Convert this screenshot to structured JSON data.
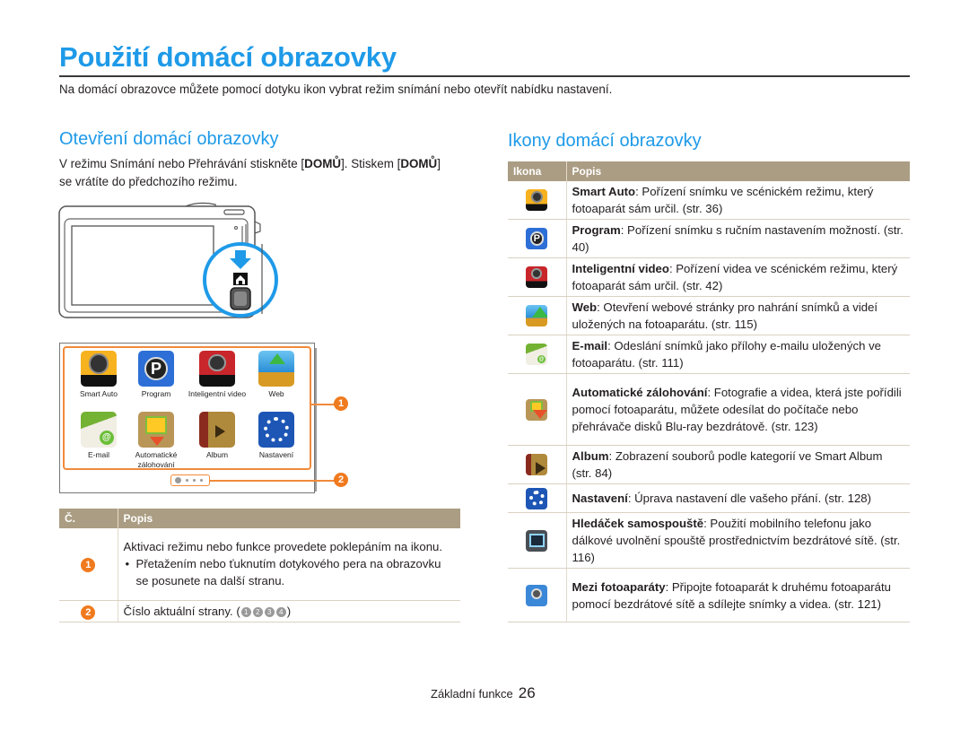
{
  "page": {
    "title": "Použití domácí obrazovky",
    "intro": "Na domácí obrazovce můžete pomocí dotyku ikon vybrat režim snímání nebo otevřít nabídku nastavení."
  },
  "left_section": {
    "heading": "Otevření domácí obrazovky",
    "para_part1": "V režimu Snímání nebo Přehrávání stiskněte [",
    "para_bold1": "DOMŮ",
    "para_part2": "]. Stiskem [",
    "para_bold2": "DOMŮ",
    "para_part3": "] se vrátíte do předchozího režimu.",
    "home_screen": {
      "apps": [
        {
          "label": "Smart Auto",
          "icon": "smart-auto-icon"
        },
        {
          "label": "Program",
          "icon": "program-icon"
        },
        {
          "label": "Inteligentní video",
          "icon": "smart-movie-icon"
        },
        {
          "label": "Web",
          "icon": "web-upload-icon"
        },
        {
          "label": "E-mail",
          "icon": "email-icon"
        },
        {
          "label": "Automatické zálohování",
          "icon": "auto-backup-icon"
        },
        {
          "label": "Album",
          "icon": "album-icon"
        },
        {
          "label": "Nastavení",
          "icon": "settings-gear-icon"
        }
      ],
      "callouts": [
        "1",
        "2"
      ],
      "page_indicator": {
        "current": 1,
        "total": 4
      }
    },
    "table": {
      "headers": [
        "Č.",
        "Popis"
      ],
      "rows": [
        {
          "num": "1",
          "text": "Aktivaci režimu nebo funkce provedete poklepáním na ikonu.",
          "bullet": "Přetažením nebo ťuknutím dotykového pera na obrazovku se posunete na další stranu."
        },
        {
          "num": "2",
          "text": "Číslo aktuální strany. (",
          "page_markers": [
            "1",
            "2",
            "3",
            "4"
          ],
          "text_end": ")"
        }
      ]
    }
  },
  "right_section": {
    "heading": "Ikony domácí obrazovky",
    "table": {
      "headers": [
        "Ikona",
        "Popis"
      ],
      "rows": [
        {
          "icon": "smart-auto-icon",
          "name": "Smart Auto",
          "desc": ": Pořízení snímku ve scénickém režimu, který fotoaparát sám určil. (str. 36)"
        },
        {
          "icon": "program-icon",
          "name": "Program",
          "desc": ": Pořízení snímku s ručním nastavením možností. (str. 40)"
        },
        {
          "icon": "smart-movie-icon",
          "name": "Inteligentní video",
          "desc": ": Pořízení videa ve scénickém režimu, který fotoaparát sám určil. (str. 42)"
        },
        {
          "icon": "web-upload-icon",
          "name": "Web",
          "desc": ": Otevření webové stránky pro nahrání snímků a videí uložených na fotoaparátu. (str. 115)"
        },
        {
          "icon": "email-icon",
          "name": "E-mail",
          "desc": ": Odeslání snímků jako přílohy e-mailu uložených ve fotoaparátu. (str. 111)"
        },
        {
          "icon": "auto-backup-icon",
          "name": "Automatické zálohování",
          "desc": ": Fotografie a videa, která jste pořídili pomocí fotoaparátu, můžete odesílat do počítače nebo přehrávače disků Blu-ray bezdrátově. (str. 123)"
        },
        {
          "icon": "album-icon",
          "name": "Album",
          "desc": ": Zobrazení souborů podle kategorií ve Smart Album (str. 84)"
        },
        {
          "icon": "settings-gear-icon",
          "name": "Nastavení",
          "desc": ": Úprava nastavení dle vašeho přání. (str. 128)"
        },
        {
          "icon": "remote-viewfinder-icon",
          "name": "Hledáček samospouště",
          "desc": ": Použití mobilního telefonu jako dálkové uvolnění spouště prostřednictvím bezdrátové sítě. (str. 116)"
        },
        {
          "icon": "camera-to-camera-icon",
          "name": "Mezi fotoaparáty",
          "desc": ": Připojte fotoaparát k druhému fotoaparátu pomocí bezdrátové sítě a sdílejte snímky a videa. (str. 121)"
        }
      ]
    }
  },
  "footer": {
    "section": "Základní funkce",
    "page_number": "26"
  },
  "colors": {
    "accent_blue": "#1e9ae8",
    "callout_orange": "#f07a1e",
    "table_header": "#ab9d83"
  }
}
